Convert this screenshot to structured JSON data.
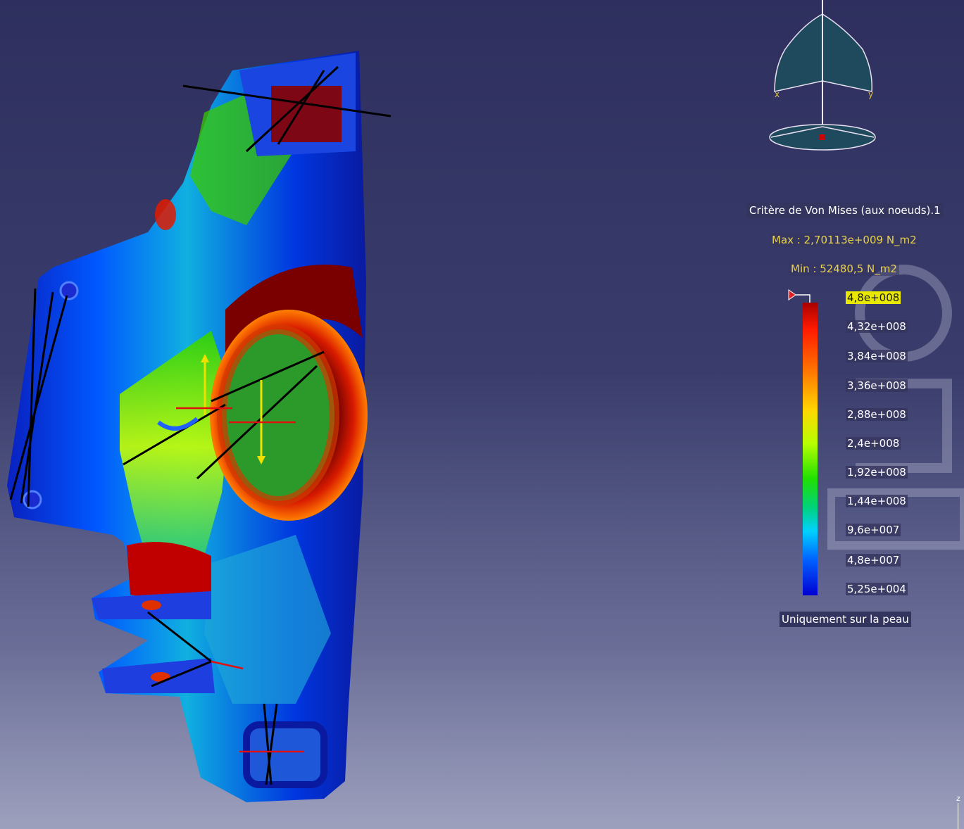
{
  "legend": {
    "title": "Critère de Von Mises (aux noeuds).1",
    "max": "Max : 2,70113e+009 N_m2",
    "min": "Min : 52480,5 N_m2",
    "ticks": [
      "4,8e+008",
      "4,32e+008",
      "3,84e+008",
      "3,36e+008",
      "2,88e+008",
      "2,4e+008",
      "1,92e+008",
      "1,44e+008",
      "9,6e+007",
      "4,8e+007",
      "5,25e+004"
    ],
    "selected_tick": "4,8e+008",
    "skin_note": "Uniquement sur la peau"
  },
  "compass": {
    "x_label": "x",
    "y_label": "y"
  },
  "axis": {
    "z_label": "z"
  },
  "colors": {
    "background_top": "#2e2f5e",
    "background_bottom": "#9da0bd",
    "legend_accent": "#e8d24a",
    "selected_tick_bg": "#e8e800"
  },
  "icons": [
    "compass-icon",
    "colorbar-flag-icon",
    "restraint-symbol-icon",
    "load-arrow-icon"
  ]
}
